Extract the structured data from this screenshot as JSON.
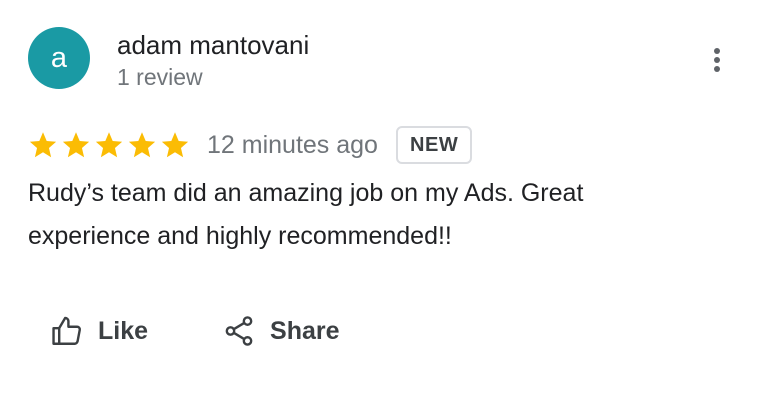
{
  "review": {
    "author": {
      "initial": "a",
      "name": "adam mantovani",
      "meta": "1 review",
      "avatar_color": "#1a9aa4"
    },
    "menu_icon": "more-vertical-icon",
    "rating": {
      "stars": 5,
      "max_stars": 5,
      "star_color": "#fbbc04"
    },
    "timestamp": "12 minutes ago",
    "badge": "NEW",
    "text": "Rudy’s team did an amazing job on my Ads. Great experience and highly recommended!!"
  },
  "actions": {
    "like": {
      "label": "Like",
      "icon": "thumbs-up-icon"
    },
    "share": {
      "label": "Share",
      "icon": "share-icon"
    }
  }
}
